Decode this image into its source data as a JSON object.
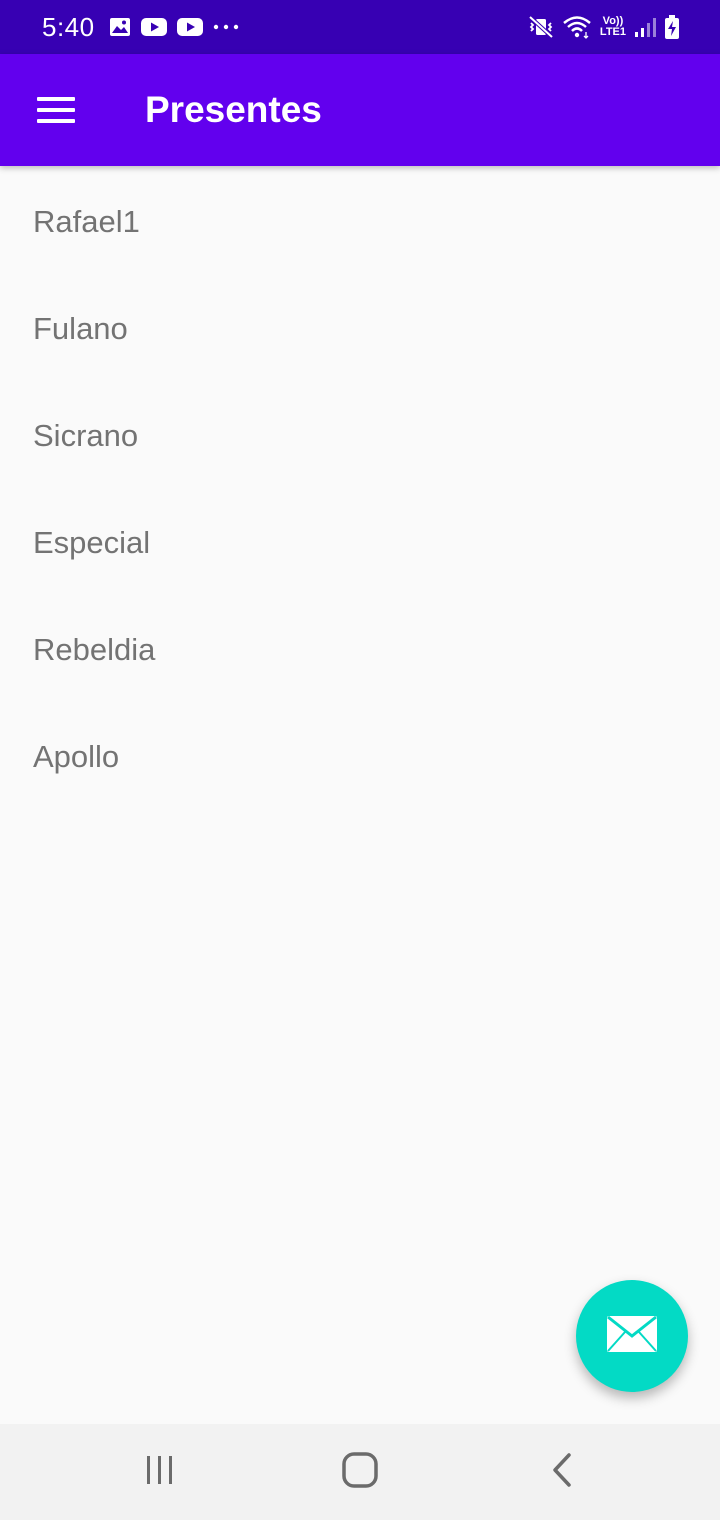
{
  "status_bar": {
    "time": "5:40",
    "left_icons": [
      "gallery-icon",
      "youtube-icon",
      "youtube-icon",
      "more-notifications-icon"
    ],
    "right_icons": [
      "vibrate-mute-icon",
      "wifi-icon",
      "volte-icon",
      "signal-icon",
      "battery-charging-icon"
    ],
    "volte_line1": "Vo))",
    "volte_line2": "LTE1"
  },
  "app_bar": {
    "menu_icon": "hamburger-menu-icon",
    "title": "Presentes"
  },
  "list": {
    "items": [
      {
        "label": "Rafael1"
      },
      {
        "label": "Fulano"
      },
      {
        "label": "Sicrano"
      },
      {
        "label": "Especial"
      },
      {
        "label": "Rebeldia"
      },
      {
        "label": "Apollo"
      }
    ]
  },
  "fab": {
    "icon": "email-icon"
  },
  "nav_bar": {
    "icons": [
      "recent-apps-icon",
      "home-icon",
      "back-icon"
    ]
  },
  "colors": {
    "status_bar": "#3700b3",
    "app_bar": "#6200ee",
    "fab": "#03dac5",
    "background": "#fafafa",
    "list_text": "#737373",
    "nav_bar": "#f2f2f2"
  }
}
